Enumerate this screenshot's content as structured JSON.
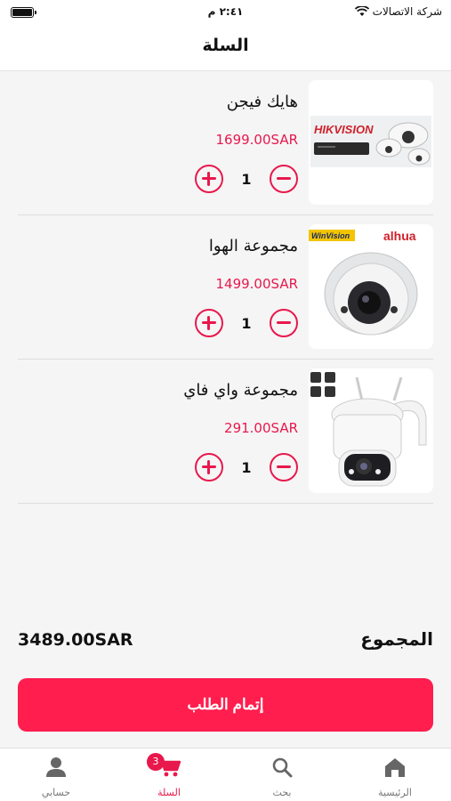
{
  "status_bar": {
    "carrier": "شركة الاتصالات",
    "time": "٢:٤١ م"
  },
  "header": {
    "title": "السلة"
  },
  "items": [
    {
      "name": "هايك فيجن",
      "price": "1699.00SAR",
      "quantity": "1",
      "brand_text": "HIKVISION"
    },
    {
      "name": "مجموعة الهوا",
      "price": "1499.00SAR",
      "quantity": "1",
      "brand_text": "alhua",
      "brand_text_2": "WinVision"
    },
    {
      "name": "مجموعة واي فاي",
      "price": "291.00SAR",
      "quantity": "1"
    }
  ],
  "summary": {
    "total_label": "المجموع",
    "total_amount": "3489.00SAR"
  },
  "checkout": {
    "label": "إتمام الطلب"
  },
  "tabbar": {
    "tabs": [
      {
        "label": "الرئيسية",
        "icon": "home-icon"
      },
      {
        "label": "بحث",
        "icon": "search-icon"
      },
      {
        "label": "السلة",
        "icon": "cart-icon",
        "badge": "3"
      },
      {
        "label": "حسابي",
        "icon": "user-icon"
      }
    ]
  },
  "colors": {
    "accent": "#e8184c",
    "button": "#ff1e4e"
  }
}
